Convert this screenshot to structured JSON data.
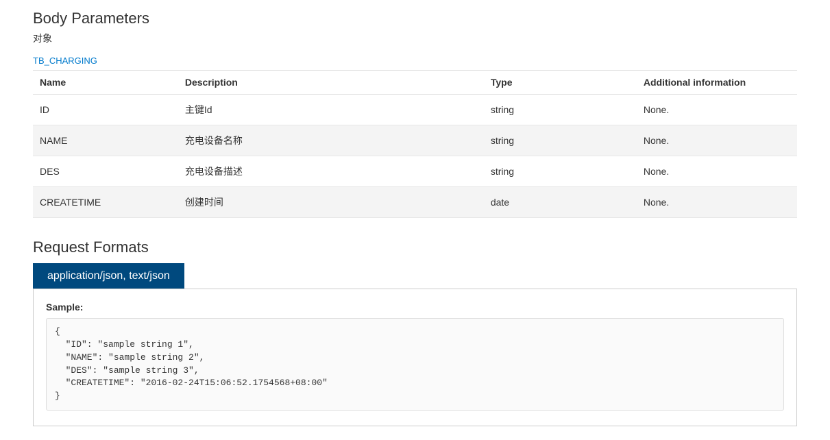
{
  "body_parameters": {
    "heading": "Body Parameters",
    "subtitle": "对象",
    "model_link": "TB_CHARGING",
    "table": {
      "headers": {
        "name": "Name",
        "description": "Description",
        "type": "Type",
        "additional": "Additional information"
      },
      "rows": [
        {
          "name": "ID",
          "description": "主键Id",
          "type": "string",
          "additional": "None."
        },
        {
          "name": "NAME",
          "description": "充电设备名称",
          "type": "string",
          "additional": "None."
        },
        {
          "name": "DES",
          "description": "充电设备描述",
          "type": "string",
          "additional": "None."
        },
        {
          "name": "CREATETIME",
          "description": "创建时间",
          "type": "date",
          "additional": "None."
        }
      ]
    }
  },
  "request_formats": {
    "heading": "Request Formats",
    "tab_label": "application/json, text/json",
    "sample_label": "Sample:",
    "sample_code": "{\n  \"ID\": \"sample string 1\",\n  \"NAME\": \"sample string 2\",\n  \"DES\": \"sample string 3\",\n  \"CREATETIME\": \"2016-02-24T15:06:52.1754568+08:00\"\n}"
  }
}
